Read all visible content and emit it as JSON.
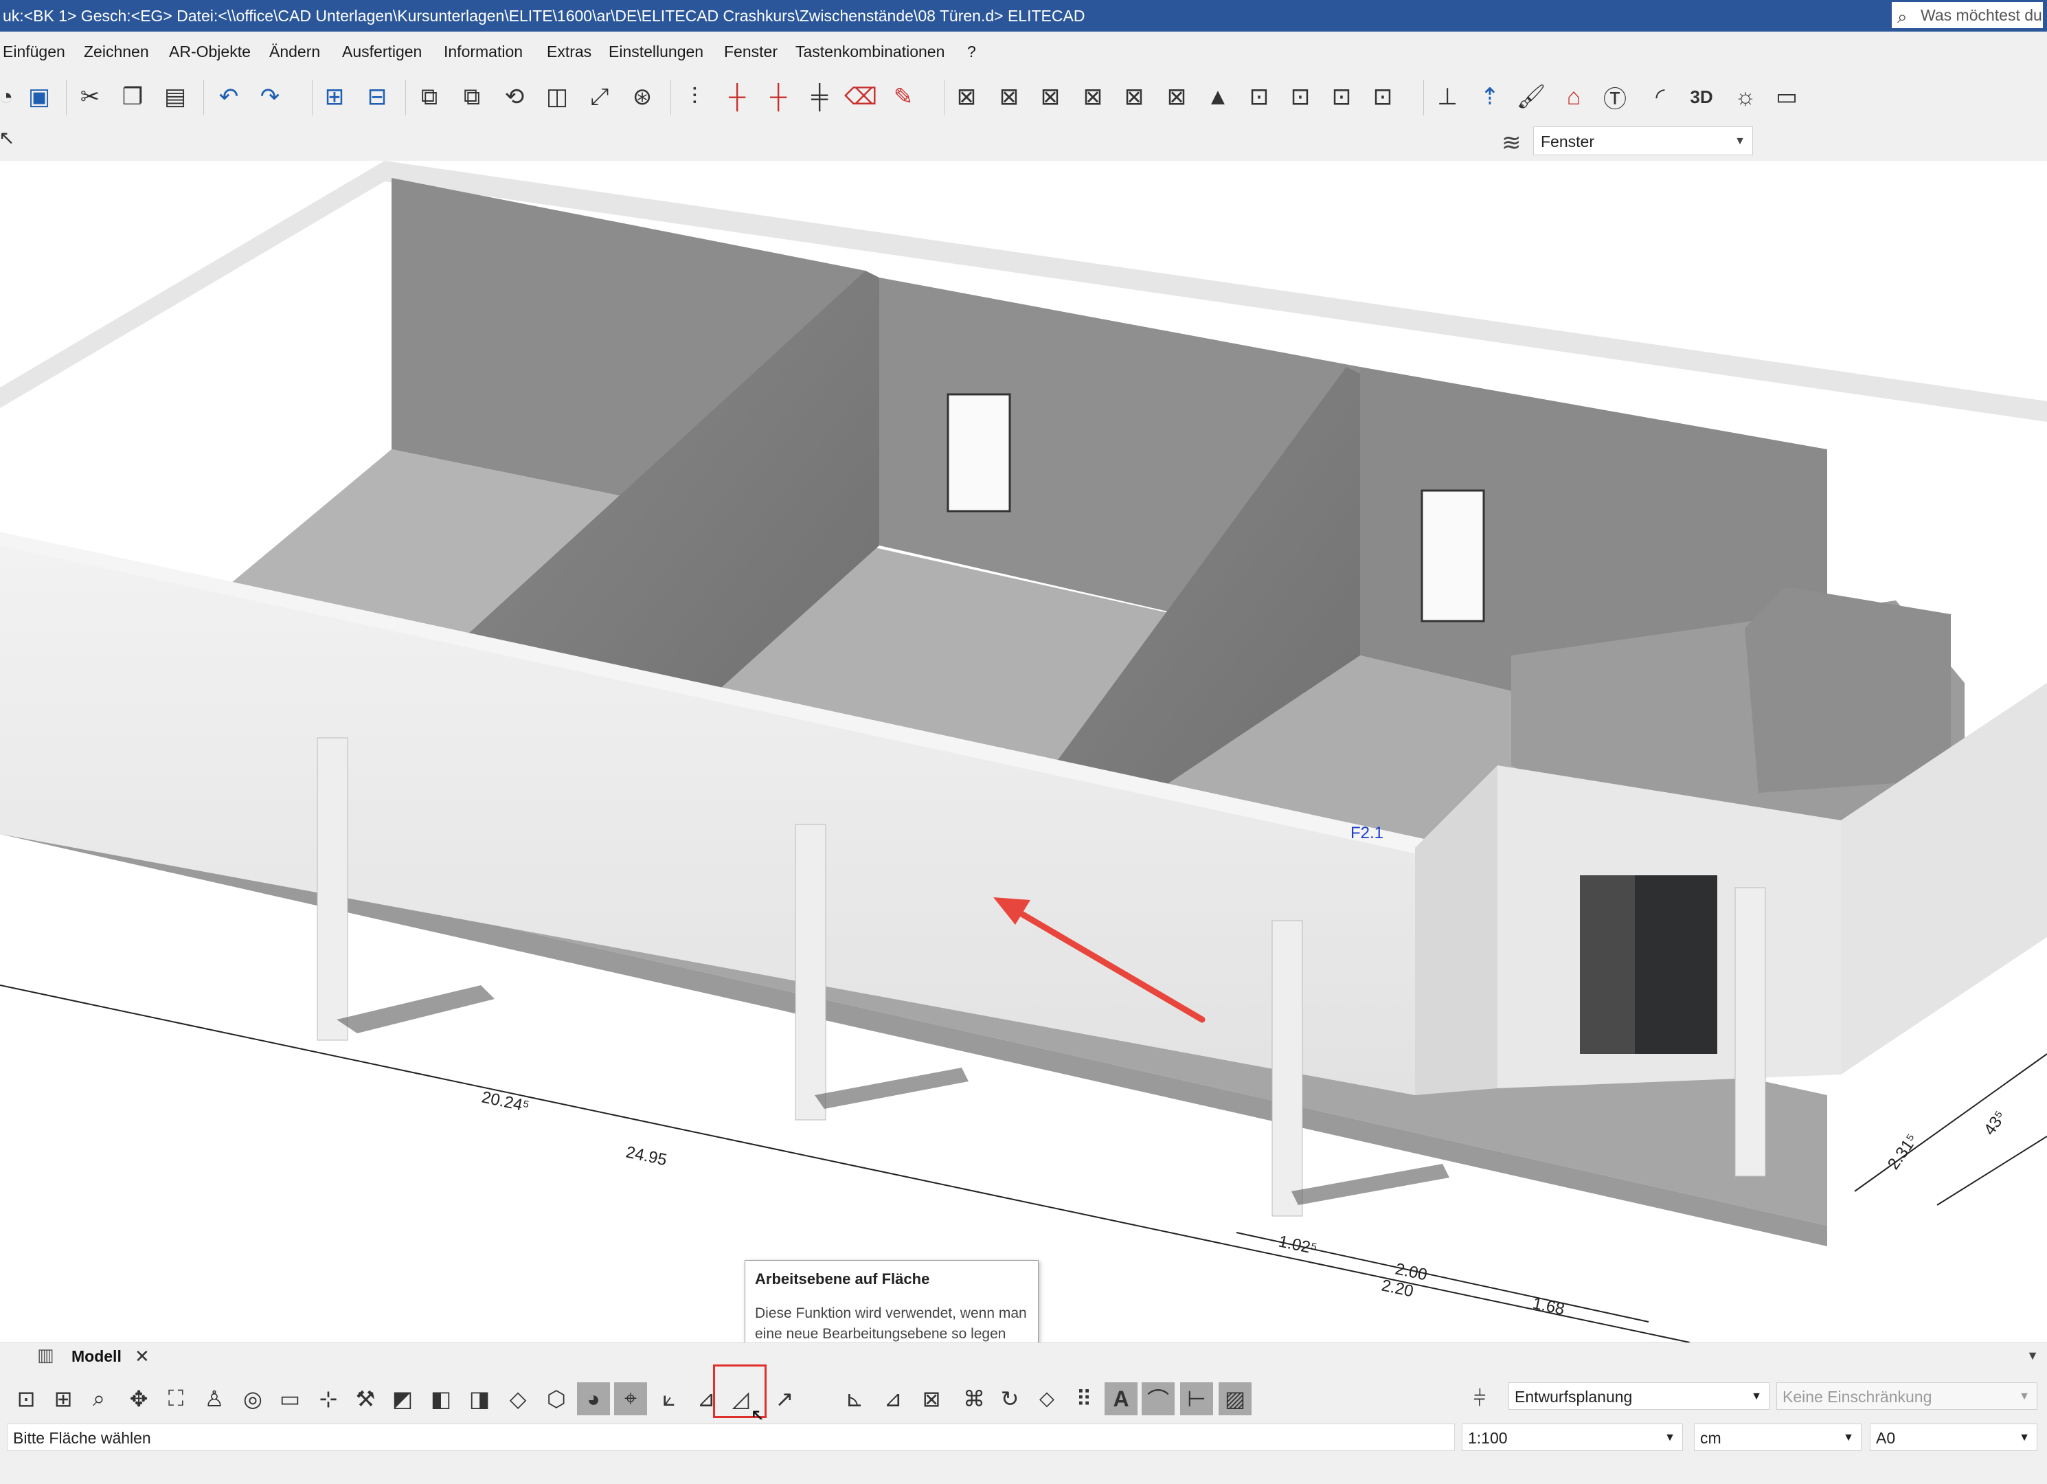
{
  "titlebar": {
    "title": "uk:<BK 1>  Gesch:<EG>  Datei:<\\\\office\\CAD Unterlagen\\Kursunterlagen\\ELITE\\1600\\ar\\DE\\ELITECAD Crashkurs\\Zwischenstände\\08 Türen.d>  ELITECAD",
    "search_placeholder": "Was möchtest du"
  },
  "menu": [
    "Einfügen",
    "Zeichnen",
    "AR-Objekte",
    "Ändern",
    "Ausfertigen",
    "Information",
    "Extras",
    "Einstellungen",
    "Fenster",
    "Tastenkombinationen",
    "?"
  ],
  "toolbar": {
    "layer_label": "Fenster"
  },
  "view_tabs": [
    {
      "label": "Modell"
    }
  ],
  "viewport_labels": {
    "dim1": "20.24⁵",
    "dim2": "24.95",
    "dim3": "1.02⁵",
    "dim4": "2.00",
    "dim5": "2.20",
    "dim6": "1.68",
    "dim7": "2.31⁵",
    "dim8": "43⁵",
    "window_tag": "F2.1"
  },
  "tooltip": {
    "title": "Arbeitsebene auf Fläche",
    "description": "Diese Funktion wird verwendet, wenn man eine neue Bearbeitungsebene so legen möchte, dass sie genau auf einer bereits vorhandenen Fläche liegt."
  },
  "status": {
    "command_prompt": "Bitte Fläche wählen",
    "planning_mode": "Entwurfsplanung",
    "restriction": "Keine Einschränkung",
    "scale": "1:100",
    "unit": "cm",
    "paper": "A0"
  },
  "colors": {
    "titlebar": "#2b579a",
    "highlight": "#e0302c",
    "arrow": "#e8463c"
  }
}
